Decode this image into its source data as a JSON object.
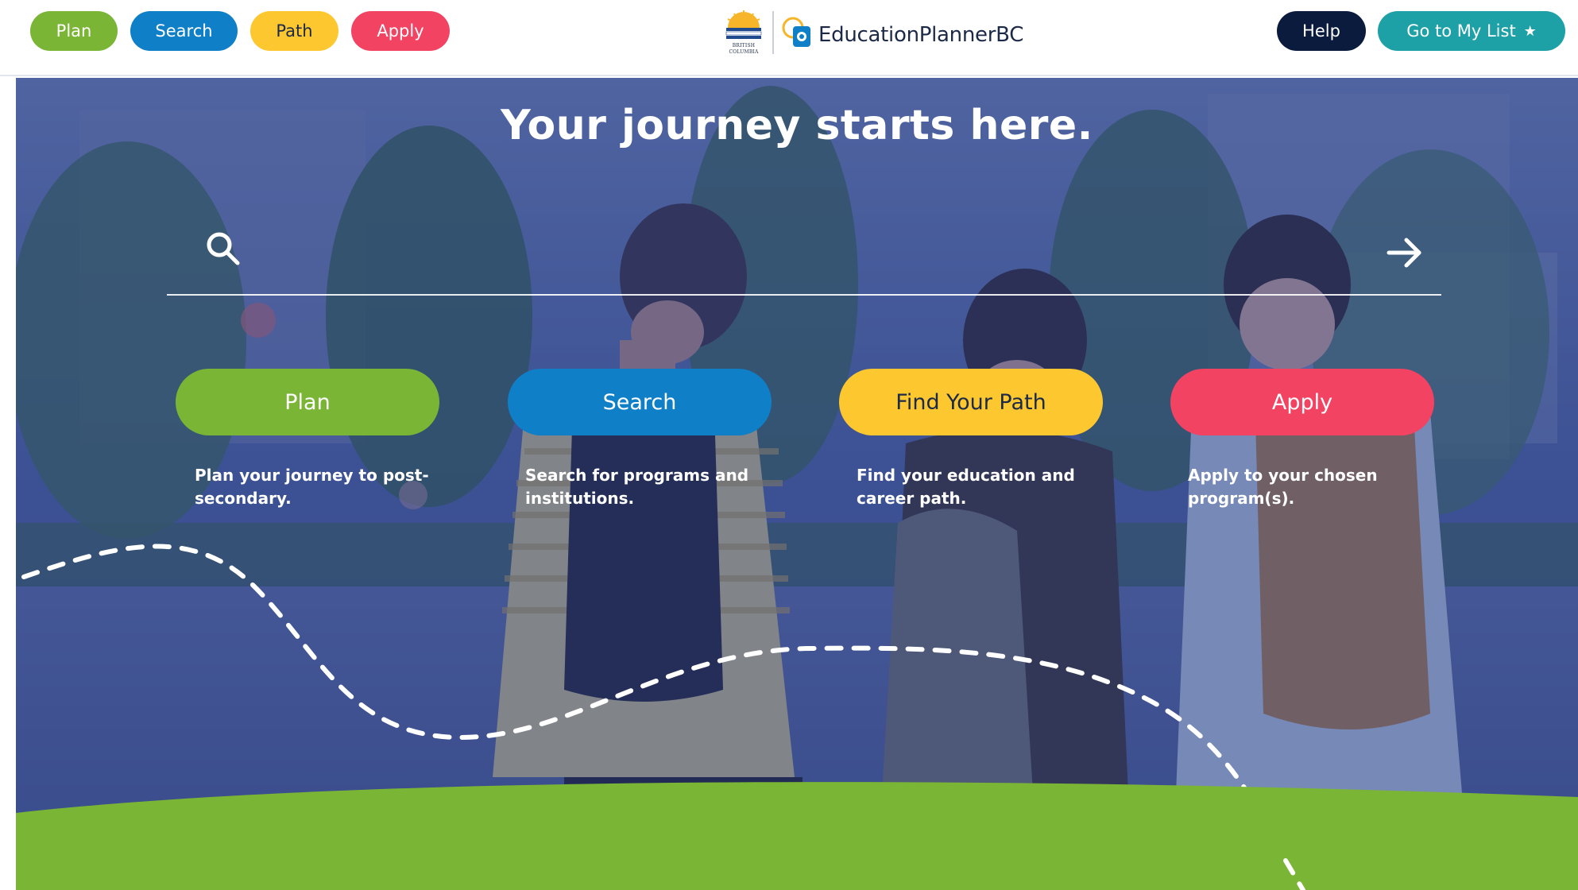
{
  "header": {
    "nav": {
      "plan": "Plan",
      "search": "Search",
      "path": "Path",
      "apply": "Apply"
    },
    "logo": {
      "bc_caption_line1": "BRITISH",
      "bc_caption_line2": "COLUMBIA",
      "brand_name": "EducationPlannerBC"
    },
    "help_label": "Help",
    "my_list_label": "Go to My List",
    "my_list_icon": "star-icon"
  },
  "hero": {
    "title": "Your journey starts here.",
    "search": {
      "placeholder": "",
      "value": "",
      "icon": "search-icon",
      "submit_icon": "arrow-right-icon"
    },
    "cards": {
      "plan": {
        "button_label": "Plan",
        "description": "Plan your journey to post-secondary."
      },
      "search": {
        "button_label": "Search",
        "description": "Search for programs and institutions."
      },
      "path": {
        "button_label": "Find Your Path",
        "description": "Find your education and career path."
      },
      "apply": {
        "button_label": "Apply",
        "description": "Apply to your chosen program(s)."
      }
    }
  },
  "colors": {
    "plan": "#7ab535",
    "search": "#0f7fc8",
    "path": "#fcc72f",
    "apply": "#f24363",
    "help": "#0b1b3d",
    "my_list": "#1da0a6",
    "hero_overlay": "#2b3f86"
  }
}
